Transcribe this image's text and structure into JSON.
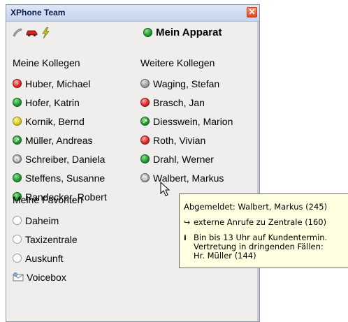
{
  "window": {
    "title": "XPhone Team",
    "close_icon": "close-icon"
  },
  "toolbar": {
    "icons": [
      "phone-handset-icon",
      "car-icon",
      "lightning-icon"
    ]
  },
  "my_device": {
    "label": "Mein Apparat",
    "status": "green"
  },
  "my_colleagues": {
    "header": "Meine Kollegen",
    "items": [
      {
        "name": "Huber, Michael",
        "status": "red",
        "badge": "!"
      },
      {
        "name": "Hofer, Katrin",
        "status": "green"
      },
      {
        "name": "Kornik, Bernd",
        "status": "yellow"
      },
      {
        "name": "Müller, Andreas",
        "status": "green",
        "badge": "↗"
      },
      {
        "name": "Schreiber, Daniela",
        "status": "gray",
        "badge": "◷"
      },
      {
        "name": "Steffens, Susanne",
        "status": "green"
      },
      {
        "name": "Randecker, Robert",
        "status": "green"
      }
    ]
  },
  "other_colleagues": {
    "header": "Weitere Kollegen",
    "items": [
      {
        "name": "Waging, Stefan",
        "status": "gray"
      },
      {
        "name": "Brasch, Jan",
        "status": "red"
      },
      {
        "name": "Diesswein, Marion",
        "status": "green",
        "badge": "↗"
      },
      {
        "name": "Roth, Vivian",
        "status": "red"
      },
      {
        "name": "Drahl, Werner",
        "status": "green"
      },
      {
        "name": "Walbert, Markus",
        "status": "gray",
        "badge": "◷"
      }
    ]
  },
  "favorites": {
    "header": "Meine Favoriten",
    "items": [
      {
        "name": "Daheim",
        "status": "empty"
      },
      {
        "name": "Taxizentrale",
        "status": "empty"
      },
      {
        "name": "Auskunft",
        "status": "empty"
      },
      {
        "name": "Voicebox",
        "icon": "voicebox-icon"
      }
    ]
  },
  "tooltip": {
    "line1": "Abgemeldet: Walbert, Markus (245)",
    "line2_icon": "↪",
    "line2": "externe Anrufe zu Zentrale (160)",
    "line3_icon": "i",
    "line3": "Bin bis 13 Uhr auf Kundentermin.\nVertretung in dringenden Fällen:\nHr. Müller (144)"
  }
}
